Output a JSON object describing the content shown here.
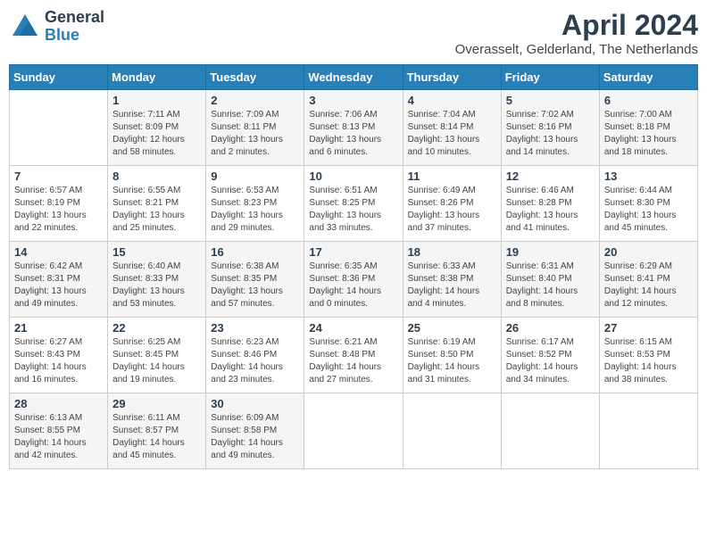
{
  "logo": {
    "general": "General",
    "blue": "Blue"
  },
  "header": {
    "month_year": "April 2024",
    "location": "Overasselt, Gelderland, The Netherlands"
  },
  "weekdays": [
    "Sunday",
    "Monday",
    "Tuesday",
    "Wednesday",
    "Thursday",
    "Friday",
    "Saturday"
  ],
  "weeks": [
    [
      null,
      {
        "day": "1",
        "sunrise": "Sunrise: 7:11 AM",
        "sunset": "Sunset: 8:09 PM",
        "daylight": "Daylight: 12 hours and 58 minutes."
      },
      {
        "day": "2",
        "sunrise": "Sunrise: 7:09 AM",
        "sunset": "Sunset: 8:11 PM",
        "daylight": "Daylight: 13 hours and 2 minutes."
      },
      {
        "day": "3",
        "sunrise": "Sunrise: 7:06 AM",
        "sunset": "Sunset: 8:13 PM",
        "daylight": "Daylight: 13 hours and 6 minutes."
      },
      {
        "day": "4",
        "sunrise": "Sunrise: 7:04 AM",
        "sunset": "Sunset: 8:14 PM",
        "daylight": "Daylight: 13 hours and 10 minutes."
      },
      {
        "day": "5",
        "sunrise": "Sunrise: 7:02 AM",
        "sunset": "Sunset: 8:16 PM",
        "daylight": "Daylight: 13 hours and 14 minutes."
      },
      {
        "day": "6",
        "sunrise": "Sunrise: 7:00 AM",
        "sunset": "Sunset: 8:18 PM",
        "daylight": "Daylight: 13 hours and 18 minutes."
      }
    ],
    [
      {
        "day": "7",
        "sunrise": "Sunrise: 6:57 AM",
        "sunset": "Sunset: 8:19 PM",
        "daylight": "Daylight: 13 hours and 22 minutes."
      },
      {
        "day": "8",
        "sunrise": "Sunrise: 6:55 AM",
        "sunset": "Sunset: 8:21 PM",
        "daylight": "Daylight: 13 hours and 25 minutes."
      },
      {
        "day": "9",
        "sunrise": "Sunrise: 6:53 AM",
        "sunset": "Sunset: 8:23 PM",
        "daylight": "Daylight: 13 hours and 29 minutes."
      },
      {
        "day": "10",
        "sunrise": "Sunrise: 6:51 AM",
        "sunset": "Sunset: 8:25 PM",
        "daylight": "Daylight: 13 hours and 33 minutes."
      },
      {
        "day": "11",
        "sunrise": "Sunrise: 6:49 AM",
        "sunset": "Sunset: 8:26 PM",
        "daylight": "Daylight: 13 hours and 37 minutes."
      },
      {
        "day": "12",
        "sunrise": "Sunrise: 6:46 AM",
        "sunset": "Sunset: 8:28 PM",
        "daylight": "Daylight: 13 hours and 41 minutes."
      },
      {
        "day": "13",
        "sunrise": "Sunrise: 6:44 AM",
        "sunset": "Sunset: 8:30 PM",
        "daylight": "Daylight: 13 hours and 45 minutes."
      }
    ],
    [
      {
        "day": "14",
        "sunrise": "Sunrise: 6:42 AM",
        "sunset": "Sunset: 8:31 PM",
        "daylight": "Daylight: 13 hours and 49 minutes."
      },
      {
        "day": "15",
        "sunrise": "Sunrise: 6:40 AM",
        "sunset": "Sunset: 8:33 PM",
        "daylight": "Daylight: 13 hours and 53 minutes."
      },
      {
        "day": "16",
        "sunrise": "Sunrise: 6:38 AM",
        "sunset": "Sunset: 8:35 PM",
        "daylight": "Daylight: 13 hours and 57 minutes."
      },
      {
        "day": "17",
        "sunrise": "Sunrise: 6:35 AM",
        "sunset": "Sunset: 8:36 PM",
        "daylight": "Daylight: 14 hours and 0 minutes."
      },
      {
        "day": "18",
        "sunrise": "Sunrise: 6:33 AM",
        "sunset": "Sunset: 8:38 PM",
        "daylight": "Daylight: 14 hours and 4 minutes."
      },
      {
        "day": "19",
        "sunrise": "Sunrise: 6:31 AM",
        "sunset": "Sunset: 8:40 PM",
        "daylight": "Daylight: 14 hours and 8 minutes."
      },
      {
        "day": "20",
        "sunrise": "Sunrise: 6:29 AM",
        "sunset": "Sunset: 8:41 PM",
        "daylight": "Daylight: 14 hours and 12 minutes."
      }
    ],
    [
      {
        "day": "21",
        "sunrise": "Sunrise: 6:27 AM",
        "sunset": "Sunset: 8:43 PM",
        "daylight": "Daylight: 14 hours and 16 minutes."
      },
      {
        "day": "22",
        "sunrise": "Sunrise: 6:25 AM",
        "sunset": "Sunset: 8:45 PM",
        "daylight": "Daylight: 14 hours and 19 minutes."
      },
      {
        "day": "23",
        "sunrise": "Sunrise: 6:23 AM",
        "sunset": "Sunset: 8:46 PM",
        "daylight": "Daylight: 14 hours and 23 minutes."
      },
      {
        "day": "24",
        "sunrise": "Sunrise: 6:21 AM",
        "sunset": "Sunset: 8:48 PM",
        "daylight": "Daylight: 14 hours and 27 minutes."
      },
      {
        "day": "25",
        "sunrise": "Sunrise: 6:19 AM",
        "sunset": "Sunset: 8:50 PM",
        "daylight": "Daylight: 14 hours and 31 minutes."
      },
      {
        "day": "26",
        "sunrise": "Sunrise: 6:17 AM",
        "sunset": "Sunset: 8:52 PM",
        "daylight": "Daylight: 14 hours and 34 minutes."
      },
      {
        "day": "27",
        "sunrise": "Sunrise: 6:15 AM",
        "sunset": "Sunset: 8:53 PM",
        "daylight": "Daylight: 14 hours and 38 minutes."
      }
    ],
    [
      {
        "day": "28",
        "sunrise": "Sunrise: 6:13 AM",
        "sunset": "Sunset: 8:55 PM",
        "daylight": "Daylight: 14 hours and 42 minutes."
      },
      {
        "day": "29",
        "sunrise": "Sunrise: 6:11 AM",
        "sunset": "Sunset: 8:57 PM",
        "daylight": "Daylight: 14 hours and 45 minutes."
      },
      {
        "day": "30",
        "sunrise": "Sunrise: 6:09 AM",
        "sunset": "Sunset: 8:58 PM",
        "daylight": "Daylight: 14 hours and 49 minutes."
      },
      null,
      null,
      null,
      null
    ]
  ]
}
